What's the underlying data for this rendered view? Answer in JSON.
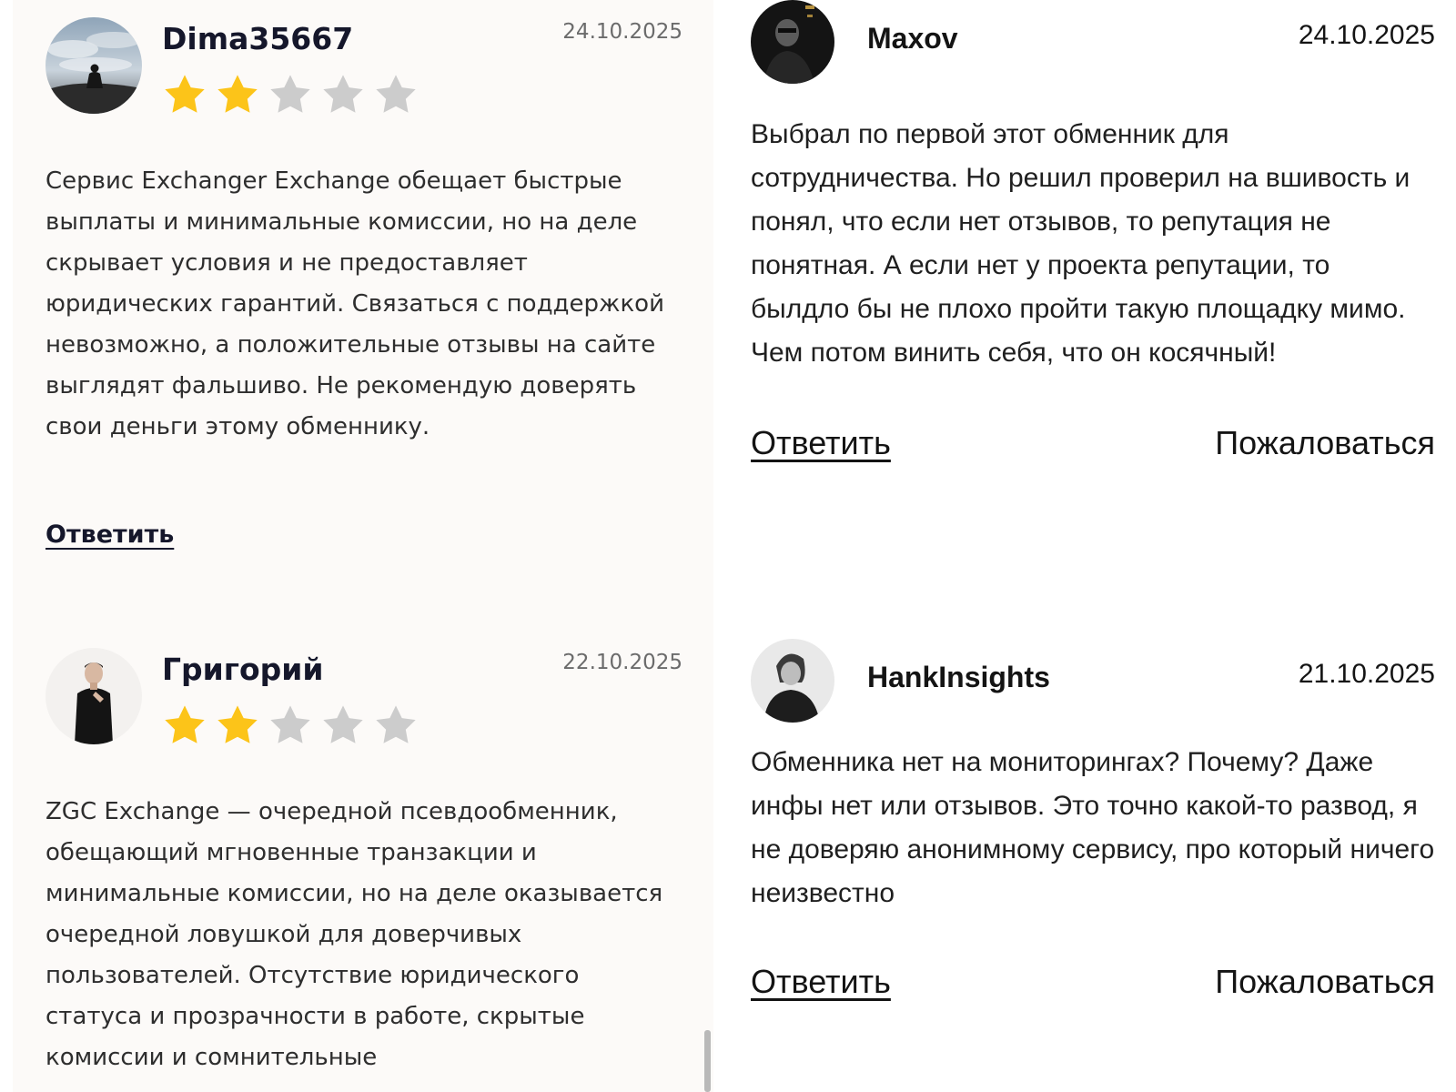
{
  "reviews_left": [
    {
      "author": "Dima35667",
      "date": "24.10.2025",
      "rating": 2,
      "max_rating": 5,
      "text": "Сервис Exchanger Exchange обещает быстрые выплаты и минимальные комиссии, но на деле скрывает условия и не предоставляет юридических гарантий. Связаться с поддержкой невозможно, а положительные отзывы на сайте выглядят фальшиво. Не рекомендую доверять свои деньги этому обменнику.",
      "reply_label": "Ответить"
    },
    {
      "author": "Григорий",
      "date": "22.10.2025",
      "rating": 2,
      "max_rating": 5,
      "text": "ZGC Exchange — очередной псевдообменник, обещающий мгновенные транзакции и минимальные комиссии, но на деле оказывается очередной ловушкой для доверчивых пользователей. Отсутствие юридического статуса и прозрачности в работе, скрытые комиссии и сомнительные"
    }
  ],
  "reviews_right": [
    {
      "author": "Maxov",
      "date": "24.10.2025",
      "text": "Выбрал по первой этот обменник для сотрудничества. Но решил проверил на вшивость и понял, что если нет отзывов, то репутация не понятная. А если нет у проекта репутации, то былдло бы не плохо пройти такую площадку мимо. Чем потом винить себя, что он косячный!",
      "reply_label": "Ответить",
      "report_label": "Пожаловаться"
    },
    {
      "author": "HankInsights",
      "date": "21.10.2025",
      "text": "Обменника нет на мониторингах? Почему? Даже инфы нет или отзывов. Это точно какой-то развод, я не доверяю анонимному сервису, про который ничего неизвестно",
      "reply_label": "Ответить",
      "report_label": "Пожаловаться"
    }
  ],
  "colors": {
    "star_filled": "#fcc419",
    "star_empty": "#cccccc",
    "left_panel_bg": "#fcfaf8",
    "heading": "#15172b"
  },
  "icons": {
    "star": "star-icon",
    "avatar": "avatar-photo"
  }
}
